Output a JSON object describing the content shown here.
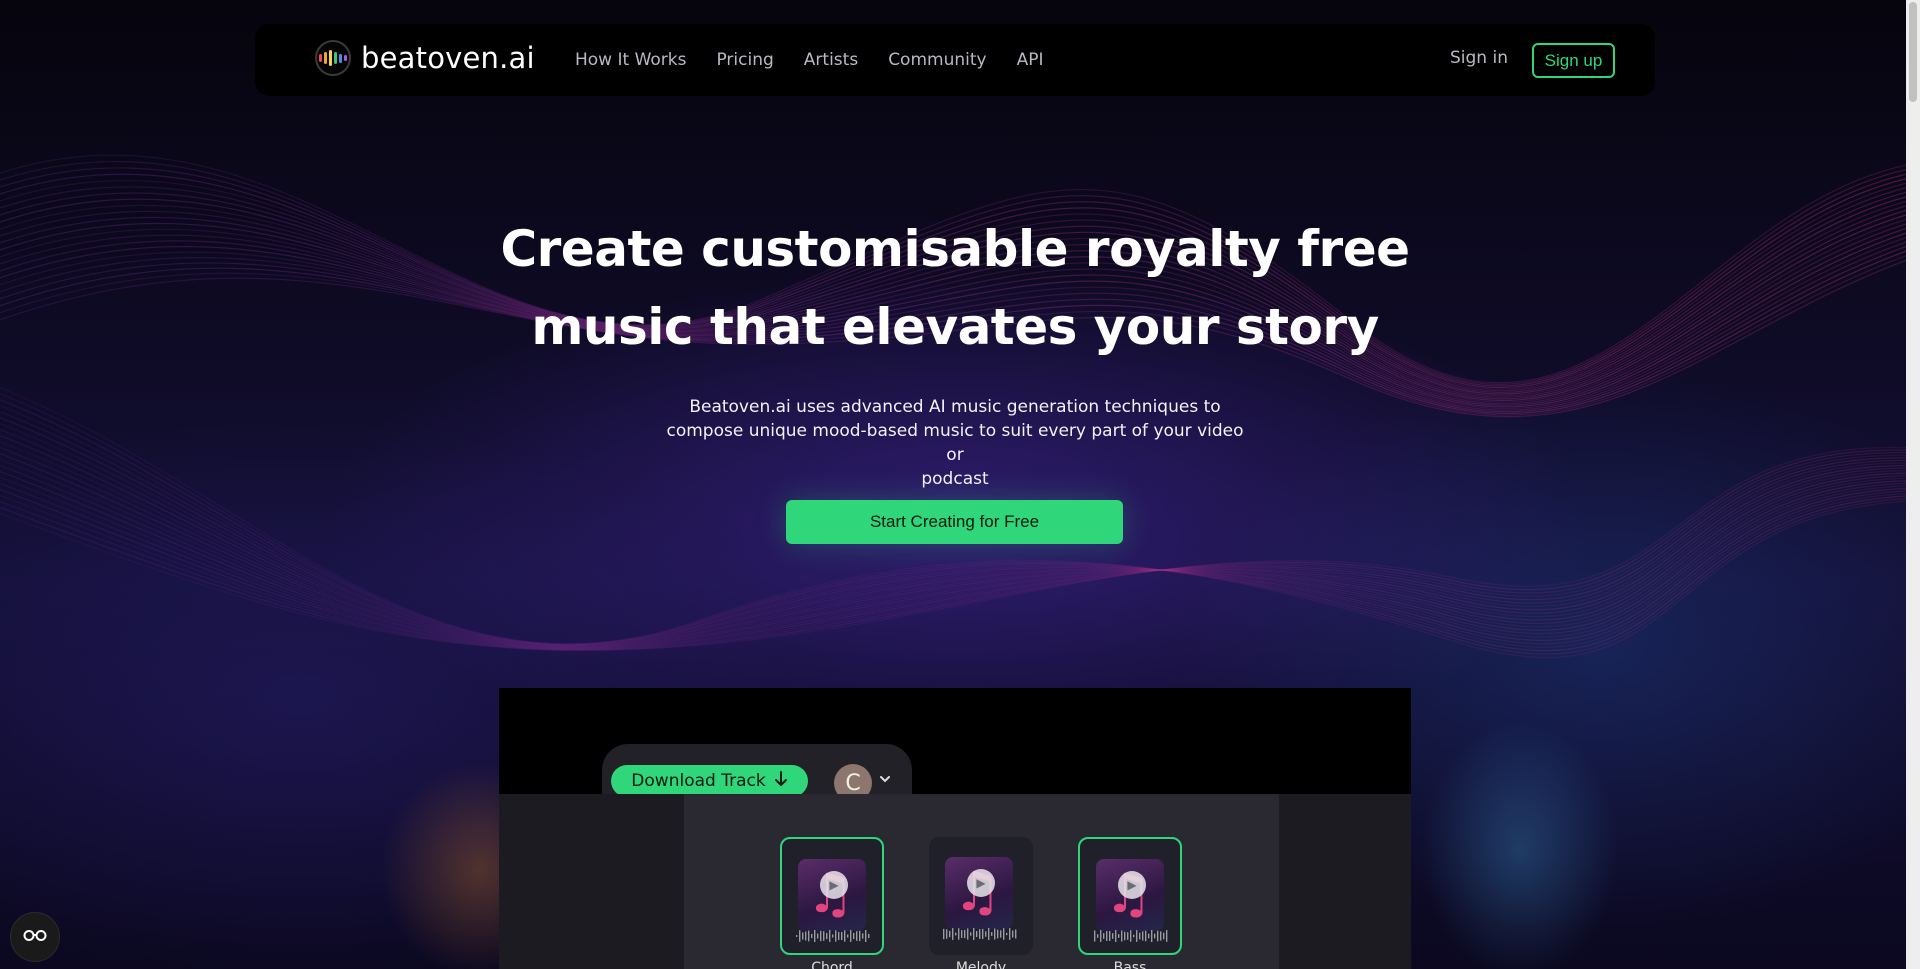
{
  "brand": {
    "name": "beatoven.ai",
    "accent": "#2fd67a",
    "logo_bar_colors": [
      "#e94b5a",
      "#f2a33a",
      "#f5d547",
      "#3fc27a",
      "#4a8fe7",
      "#a35de0"
    ]
  },
  "nav": {
    "links": [
      {
        "label": "How It Works"
      },
      {
        "label": "Pricing"
      },
      {
        "label": "Artists"
      },
      {
        "label": "Community"
      },
      {
        "label": "API"
      }
    ],
    "signin_label": "Sign in",
    "signup_label": "Sign up"
  },
  "hero": {
    "title_line1": "Create customisable royalty free",
    "title_line2": "music that elevates your story",
    "subtitle_line1": "Beatoven.ai uses advanced AI music generation techniques to",
    "subtitle_line2": "compose unique mood-based music to suit every part of your video or",
    "subtitle_line3": "podcast",
    "cta_label": "Start Creating for Free"
  },
  "preview": {
    "download_label": "Download Track",
    "download_icon": "arrow-down-icon",
    "avatar_initial": "C",
    "tracks": [
      {
        "label": "Chord",
        "selected": true
      },
      {
        "label": "Melody",
        "selected": false
      },
      {
        "label": "Bass",
        "selected": true
      }
    ]
  },
  "widget": {
    "icon": "glasses-icon"
  }
}
